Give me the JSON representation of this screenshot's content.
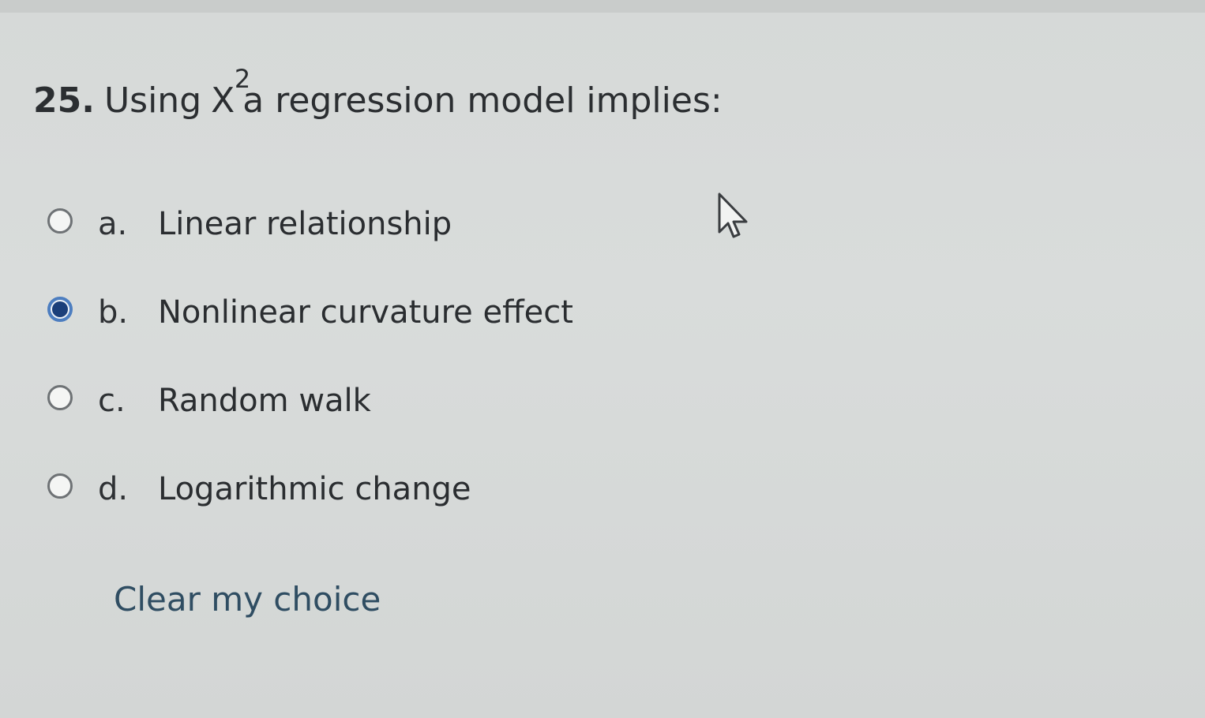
{
  "question": {
    "number": "25.",
    "text_before": "Using",
    "variable": "X",
    "exponent": "2",
    "text_after": "a regression model implies:"
  },
  "options": [
    {
      "letter": "a.",
      "text": "Linear relationship",
      "selected": false
    },
    {
      "letter": "b.",
      "text": "Nonlinear curvature effect",
      "selected": true
    },
    {
      "letter": "c.",
      "text": "Random walk",
      "selected": false
    },
    {
      "letter": "d.",
      "text": "Logarithmic change",
      "selected": false
    }
  ],
  "clear_choice_label": "Clear my choice",
  "icons": {
    "cursor": "mouse-pointer-icon"
  },
  "colors": {
    "radio_selected_ring": "#4d7ec0",
    "radio_selected_dot": "#1b3f7a",
    "link": "#2f4d62"
  }
}
